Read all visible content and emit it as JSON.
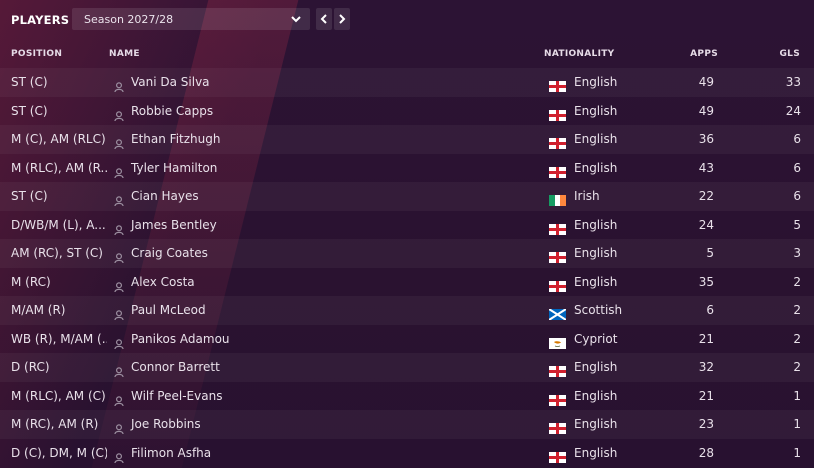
{
  "panel": {
    "title": "PLAYERS",
    "season_select": {
      "value": "Season 2027/28"
    }
  },
  "columns": {
    "position": "POSITION",
    "name": "NAME",
    "nationality": "NATIONALITY",
    "apps": "APPS",
    "gls": "GLS"
  },
  "flag_icons": {
    "English": "flag-england-icon",
    "Irish": "flag-ireland-icon",
    "Scottish": "flag-scotland-icon",
    "Cypriot": "flag-cyprus-icon"
  },
  "players": [
    {
      "position": "ST (C)",
      "name": "Vani Da Silva",
      "nationality": "English",
      "apps": "49",
      "gls": "33"
    },
    {
      "position": "ST (C)",
      "name": "Robbie Capps",
      "nationality": "English",
      "apps": "49",
      "gls": "24"
    },
    {
      "position": "M (C), AM (RLC)",
      "name": "Ethan Fitzhugh",
      "nationality": "English",
      "apps": "36",
      "gls": "6"
    },
    {
      "position": "M (RLC), AM (R...",
      "name": "Tyler Hamilton",
      "nationality": "English",
      "apps": "43",
      "gls": "6"
    },
    {
      "position": "ST (C)",
      "name": "Cian Hayes",
      "nationality": "Irish",
      "apps": "22",
      "gls": "6"
    },
    {
      "position": "D/WB/M (L), A...",
      "name": "James Bentley",
      "nationality": "English",
      "apps": "24",
      "gls": "5"
    },
    {
      "position": "AM (RC), ST (C)",
      "name": "Craig Coates",
      "nationality": "English",
      "apps": "5",
      "gls": "3"
    },
    {
      "position": "M (RC)",
      "name": "Alex Costa",
      "nationality": "English",
      "apps": "35",
      "gls": "2"
    },
    {
      "position": "M/AM (R)",
      "name": "Paul McLeod",
      "nationality": "Scottish",
      "apps": "6",
      "gls": "2"
    },
    {
      "position": "WB (R), M/AM (...",
      "name": "Panikos Adamou",
      "nationality": "Cypriot",
      "apps": "21",
      "gls": "2"
    },
    {
      "position": "D (RC)",
      "name": "Connor Barrett",
      "nationality": "English",
      "apps": "32",
      "gls": "2"
    },
    {
      "position": "M (RLC), AM (C)",
      "name": "Wilf Peel-Evans",
      "nationality": "English",
      "apps": "21",
      "gls": "1"
    },
    {
      "position": "M (RC), AM (R)",
      "name": "Joe Robbins",
      "nationality": "English",
      "apps": "23",
      "gls": "1"
    },
    {
      "position": "D (C), DM, M (C)",
      "name": "Filimon Asfha",
      "nationality": "English",
      "apps": "28",
      "gls": "1"
    }
  ]
}
